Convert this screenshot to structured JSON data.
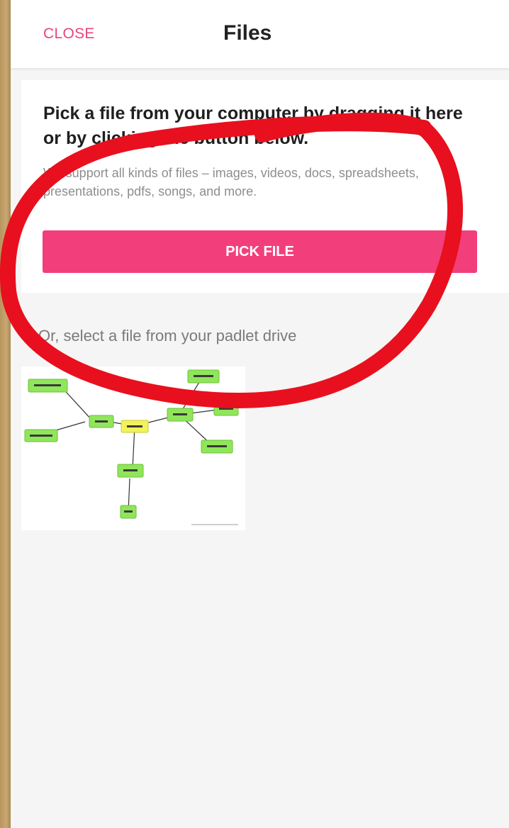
{
  "header": {
    "close_label": "CLOSE",
    "title": "Files"
  },
  "upload_card": {
    "heading": "Pick a file from your computer by dragging it here or by clicking the button below.",
    "subtext": "We support all kinds of files – images, videos, docs, spreadsheets, presentations, pdfs, songs, and more.",
    "button_label": "PICK FILE"
  },
  "drive": {
    "prompt": "Or, select a file from your padlet drive"
  },
  "colors": {
    "accent": "#f23f7b",
    "close_text": "#e8457d",
    "annotation": "#e8101e",
    "mindmap_green": "#8fe65a",
    "mindmap_yellow": "#f2f25a"
  },
  "icons": {
    "thumbnail": "mind-map-image"
  }
}
